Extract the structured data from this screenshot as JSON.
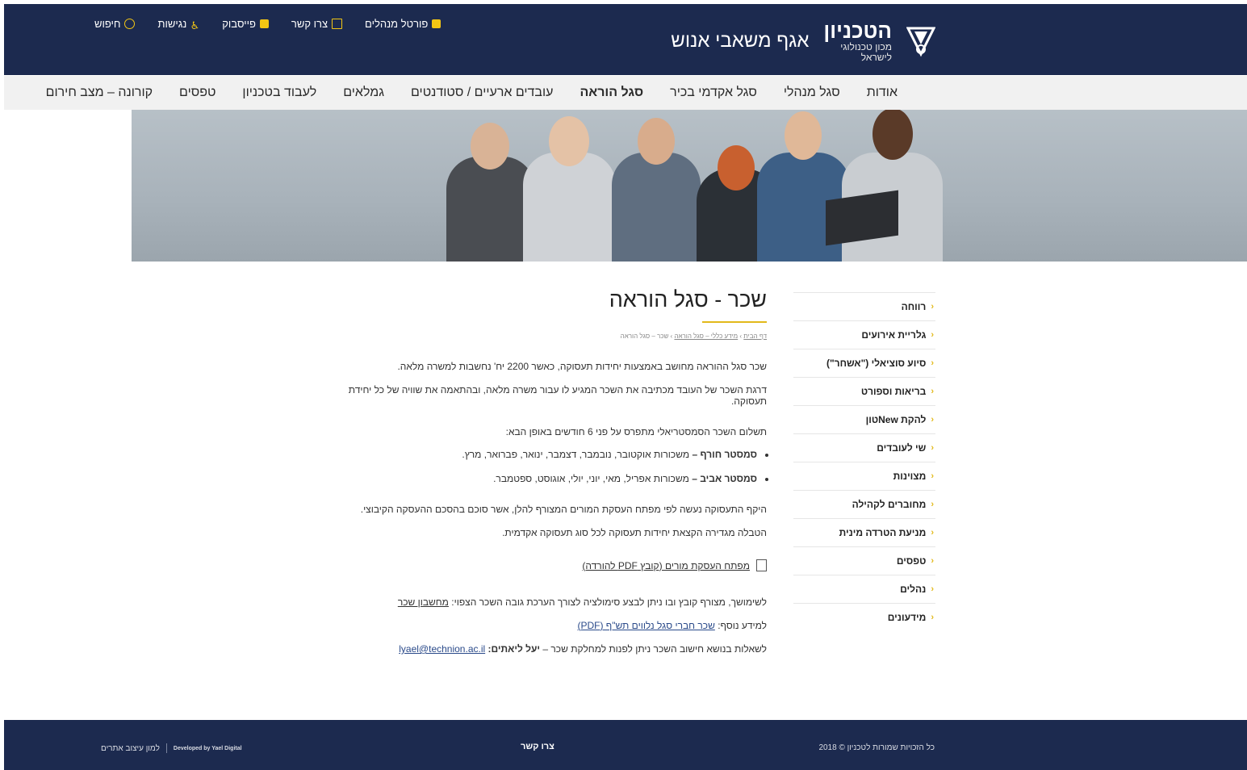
{
  "header": {
    "brand_name": "הטכניון",
    "brand_sub1": "מכון טכנולוגי",
    "brand_sub2": "לישראל",
    "department": "אגף משאבי אנוש",
    "links": [
      {
        "label": "פורטל מנהלים",
        "icon": "portal-icon"
      },
      {
        "label": "צרו קשר",
        "icon": "mail-icon"
      },
      {
        "label": "פייסבוק",
        "icon": "facebook-icon"
      },
      {
        "label": "נגישות",
        "icon": "accessibility-icon"
      },
      {
        "label": "חיפוש",
        "icon": "search-icon"
      }
    ],
    "accent": "#f3c614",
    "bg": "#1c2a4f"
  },
  "nav": {
    "items": [
      "אודות",
      "סגל מנהלי",
      "סגל אקדמי בכיר",
      "סגל הוראה",
      "עובדים ארעיים / סטודנטים",
      "גמלאים",
      "לעבוד בטכניון",
      "טפסים",
      "קורונה – מצב חירום"
    ],
    "active": "סגל הוראה"
  },
  "sidebar": {
    "items": [
      "רווחה",
      "גלריית אירועים",
      "סיוע סוציאלי (\"אשחר\")",
      "בריאות וספורט",
      "להקת Newטון",
      "שי לעובדים",
      "מצוינות",
      "מחוברים לקהילה",
      "מניעת הטרדה מינית",
      "טפסים",
      "נהלים",
      "מידעונים"
    ]
  },
  "content": {
    "title": "שכר - סגל הוראה",
    "breadcrumb": {
      "home": "דף הבית",
      "sep": " › ",
      "parent": "מידע כללי – סגל הוראה",
      "current": "שכר – סגל הוראה"
    },
    "p1": "שכר סגל ההוראה מחושב באמצעות יחידות תעסוקה, כאשר 2200 יח' נחשבות למשרה מלאה.",
    "p2": "דרגת השכר של העובד מכתיבה את השכר המגיע לו עבור משרה מלאה, ובהתאמה את שוויה של כל יחידת תעסוקה.",
    "p3": "תשלום השכר הסמסטריאלי מתפרס על פני 6 חודשים באופן הבא:",
    "bullets": [
      {
        "bold": "סמסטר חורף –",
        "text": " משכורות אוקטובר, נובמבר, דצמבר, ינואר, פברואר, מרץ."
      },
      {
        "bold": "סמסטר אביב –",
        "text": " משכורות אפריל, מאי, יוני, יולי, אוגוסט, ספטמבר."
      }
    ],
    "p4": "היקף התעסוקה נעשה לפי מפתח העסקת המורים המצורף להלן, אשר סוכם בהסכם ההעסקה הקיבוצי.",
    "p5": "הטבלה מגדירה הקצאת יחידות תעסוקה לכל סוג תעסוקה אקדמית.",
    "pdf_link": "מפתח העסקת מורים (קובץ PDF להורדה)",
    "p6_text": "לשימושך, מצורף קובץ ובו ניתן לבצע סימולציה לצורך הערכת גובה השכר הצפוי: ",
    "p6_link": "מחשבון שכר",
    "p7_text": "למידע נוסף: ",
    "p7_link": "שכר חברי סגל נלווים תש\"ף (PDF)",
    "p8_text": "לשאלות בנושא חישוב השכר ניתן לפנות למחלקת שכר – ",
    "p8_bold": "יעל ליאתים:",
    "p8_email": "lyael@technion.ac.il"
  },
  "footer": {
    "copyright": "כל הזכויות שמורות לטכניון © 2018",
    "contact": "צרו קשר",
    "developed_by": "Developed by Yael Digital",
    "studio": "למון עיצוב אתרים"
  }
}
